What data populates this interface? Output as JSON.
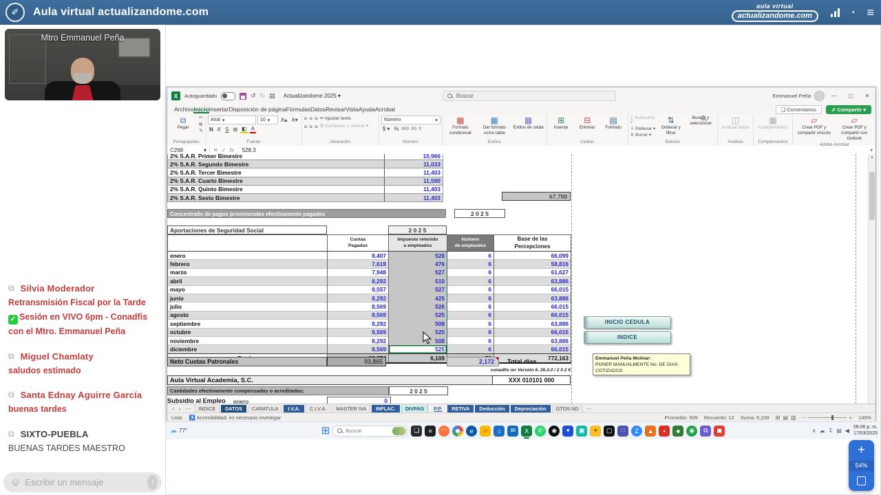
{
  "topbar": {
    "title": "Aula virtual actualizandome.com",
    "brand_line1": "aula virtual",
    "brand_line2": "actualizandome.com"
  },
  "sidebar": {
    "presenter": "Mtro Emmanuel Peña",
    "messages": {
      "m1": {
        "author": "Silvia Moderador",
        "line1": "Retransmisión Fiscal por la Tarde",
        "line2": "Sesión en VIVO 6pm - Conadfis con el Mtro. Emmanuel Peña"
      },
      "m2": {
        "author": "Miguel Chamlaty",
        "line1": "saludos estimado"
      },
      "m3": {
        "author": "Santa Ednay Aguirre García",
        "line1": "buenas tardes"
      },
      "m4": {
        "author": "SIXTO-PUEBLA",
        "line1": "BUENAS TARDES MAESTRO"
      }
    },
    "input_placeholder": "Escribir un mensaje"
  },
  "zoom_widget": {
    "percent": "54%"
  },
  "excel": {
    "titlebar": {
      "autosave_label": "Autoguardado",
      "doc_title": "Actualizandome 2025",
      "search_placeholder": "Buscar",
      "user": "Emmanuel Peña"
    },
    "actions": {
      "comments": "Comentarios",
      "share": "Compartir"
    },
    "menu": [
      {
        "label": "Archivo"
      },
      {
        "label": "Inicio",
        "mod": "active"
      },
      {
        "label": "Insertar"
      },
      {
        "label": "Disposición de página"
      },
      {
        "label": "Fórmulas"
      },
      {
        "label": "Datos"
      },
      {
        "label": "Revisar"
      },
      {
        "label": "Vista"
      },
      {
        "label": "Ayuda"
      },
      {
        "label": "Acrobat"
      }
    ],
    "ribbon": {
      "paste": "Pegar",
      "clipboard_group": "Portapapeles",
      "font_name": "Arial",
      "font_size": "10",
      "bold": "N",
      "italic": "K",
      "underline": "S",
      "font_group": "Fuente",
      "wrap": "Ajustar texto",
      "merge": "Combinar y centrar",
      "align_group": "Alineación",
      "number_format": "Número",
      "number_group": "Número",
      "currency": "$",
      "percent": "%",
      "thousands": "000",
      "cond": "Formato condicional",
      "tablefmt": "Dar formato como tabla",
      "cellstyles": "Estilos de celda",
      "styles_group": "Estilos",
      "insert": "Insertar",
      "delete": "Eliminar",
      "format": "Formato",
      "cells_group": "Celdas",
      "autosum": "Autosuma",
      "fill": "Rellenar",
      "clear": "Borrar",
      "sort": "Ordenar y filtrar",
      "find": "Buscar y seleccionar",
      "edit_group": "Edición",
      "analyze": "Analizar datos",
      "analysis_group": "Análisis",
      "addins": "Complementos",
      "addins_group": "Complementos",
      "pdf1": "Crear PDF y compartir vínculo",
      "pdf2": "Crear PDF y compartir con Outlook",
      "acrobat_group": "Adobe Acrobat"
    },
    "formula_bar": {
      "name_box": "C268",
      "fx": "fx",
      "value": "528.3"
    },
    "sheet": {
      "sar_rows": [
        {
          "label": "2% S.A.R.   Primer Bimestre",
          "value": "10,966"
        },
        {
          "label": "2% S.A.R.   Segundo Bimestre",
          "value": "11,033"
        },
        {
          "label": "2% S.A.R.   Tercer Bimestre",
          "value": "11,403"
        },
        {
          "label": "2% S.A.R.   Cuarto Bimestre",
          "value": "11,590"
        },
        {
          "label": "2% S.A.R.   Quinto Bimestre",
          "value": "11,403"
        },
        {
          "label": "2% S.A.R.   Sexto Bimestre",
          "value": "11,403"
        }
      ],
      "sar_total": "67,799",
      "concentrado_title": "Concentrado de pagos provisionales efectivamente pagados",
      "concentrado_year": "2 0 2 5",
      "table_title": "Aportaciones de Seguridad Social",
      "table_year": "2 0 2 5",
      "headers": {
        "h1l1": "Cuotas",
        "h1l2": "Pagadas",
        "h2l1": "Impuesto retenido",
        "h2l2": "a empleados",
        "h3l1": "Número",
        "h3l2": "de empleados",
        "h4l1": "Base de las",
        "h4l2": "Percepciones"
      },
      "months": [
        {
          "m": "enero",
          "c": "8,407",
          "i": "528",
          "n": "6",
          "b": "66,099"
        },
        {
          "m": "febrero",
          "c": "7,619",
          "i": "476",
          "n": "6",
          "b": "58,816"
        },
        {
          "m": "marzo",
          "c": "7,948",
          "i": "527",
          "n": "6",
          "b": "61,627"
        },
        {
          "m": "abril",
          "c": "8,292",
          "i": "510",
          "n": "6",
          "b": "63,886"
        },
        {
          "m": "mayo",
          "c": "8,557",
          "i": "527",
          "n": "6",
          "b": "66,015"
        },
        {
          "m": "junio",
          "c": "8,292",
          "i": "425",
          "n": "6",
          "b": "63,886"
        },
        {
          "m": "julio",
          "c": "8,569",
          "i": "526",
          "n": "6",
          "b": "66,015"
        },
        {
          "m": "agosto",
          "c": "8,569",
          "i": "525",
          "n": "6",
          "b": "66,015"
        },
        {
          "m": "septiembre",
          "c": "8,292",
          "i": "508",
          "n": "6",
          "b": "63,886"
        },
        {
          "m": "octubre",
          "c": "8,569",
          "i": "525",
          "n": "6",
          "b": "66,015"
        },
        {
          "m": "noviembre",
          "c": "8,292",
          "i": "508",
          "n": "6",
          "b": "63,886"
        },
        {
          "m": "diciembre",
          "c": "8,569",
          "i": "525",
          "n": "6",
          "b": "66,015"
        }
      ],
      "totals": {
        "label": "Totales",
        "c": "99,974",
        "i": "6,109",
        "n": "72",
        "b": "772,163"
      },
      "neto_label": "Neto Cuotas Patronales",
      "neto_value": "93,865",
      "dias_value": "2,172",
      "dias_label": "Total días",
      "version_line": "conadfis mr Versión 6.  26.3.0 / 2 0 2 6",
      "company": "Aula Virtual Academia, S.C.",
      "company_code": "XXX 010101 000",
      "cantidades_label": "Cantidades efectivamente compensadas o acreditadas:",
      "cantidades_year": "2 0 2 5",
      "subsidio_label": "Subsidio al Empleo",
      "subsidio_month": "enero",
      "subsidio_value": "0",
      "btn_inicio": "INICIO CEDULA",
      "btn_indice": "INDICE",
      "note_author": "Emmanuel Peña Molinar:",
      "note_text": "PONER MANUALMENTE No. DE DIAS COTIZADOS"
    },
    "sheet_tabs": [
      {
        "label": "INDICE"
      },
      {
        "label": "DATOS",
        "mod": "active"
      },
      {
        "label": "CARATULA"
      },
      {
        "label": "I.V.A.",
        "mod": "blue"
      },
      {
        "label": "C.I.V.A."
      },
      {
        "label": "MASTER IVA"
      },
      {
        "label": "INFLAC.",
        "mod": "blue"
      },
      {
        "label": "DIVPAG",
        "mod": "teal"
      },
      {
        "label": "P.P.",
        "mod": "pp"
      },
      {
        "label": "RETIVA",
        "mod": "blue"
      },
      {
        "label": "Deducción",
        "mod": "blue"
      },
      {
        "label": "Depreciación",
        "mod": "blue"
      },
      {
        "label": "GTOS ND"
      }
    ],
    "status_bar": {
      "ready": "Listo",
      "accessibility": "Accesibilidad: es necesario investigar",
      "average": "Promedio: 509",
      "count": "Recuento: 12",
      "sum": "Suma: 6,109",
      "zoom": "140%"
    }
  },
  "taskbar": {
    "weather": "77°",
    "search_placeholder": "Buscar",
    "clock_time": "06:06 p. m.",
    "clock_date": "17/03/2025",
    "icons": [
      {
        "name": "taskbar-widgets-icon",
        "glyph": "❏",
        "bg": "#26262b"
      },
      {
        "name": "taskbar-notes-icon",
        "glyph": "≡",
        "bg": "#1f1f1f"
      },
      {
        "name": "taskbar-firefox-icon",
        "glyph": "◠",
        "bg": "#ff7139",
        "mod": "round"
      },
      {
        "name": "taskbar-chrome-icon",
        "glyph": "",
        "mod": "chrome"
      },
      {
        "name": "taskbar-edge-icon",
        "glyph": "e",
        "bg": "#0c59a4",
        "mod": "round"
      },
      {
        "name": "taskbar-explorer-icon",
        "glyph": "▱",
        "bg": "#ffb900",
        "fg": "#8a5a00"
      },
      {
        "name": "taskbar-store-icon",
        "glyph": "⌂",
        "bg": "#1a6fc4"
      },
      {
        "name": "taskbar-outlook-icon",
        "glyph": "✉",
        "bg": "#0f6cbd"
      },
      {
        "name": "taskbar-excel-icon",
        "glyph": "X",
        "bg": "#107c41",
        "mod": "active"
      },
      {
        "name": "taskbar-whatsapp-icon",
        "glyph": "✆",
        "bg": "#25d366",
        "mod": "round"
      },
      {
        "name": "taskbar-obs-icon",
        "glyph": "◉",
        "bg": "#0d0d0d",
        "mod": "round"
      },
      {
        "name": "taskbar-app-blue-icon",
        "glyph": "✦",
        "bg": "#1d4ed8"
      },
      {
        "name": "taskbar-app-teal-icon",
        "glyph": "▣",
        "bg": "#14b8a6"
      },
      {
        "name": "taskbar-app-yellow-icon",
        "glyph": "✦",
        "bg": "#fbbf24",
        "fg": "#7a5200"
      },
      {
        "name": "taskbar-camera-icon",
        "glyph": "▢",
        "bg": "#111111"
      },
      {
        "name": "taskbar-teams-icon",
        "glyph": "∷",
        "bg": "#4f52b2"
      },
      {
        "name": "taskbar-zoom-icon",
        "glyph": "Z",
        "bg": "#2d8cff",
        "mod": "round"
      },
      {
        "name": "taskbar-vlc-icon",
        "glyph": "▲",
        "bg": "#e8711a"
      },
      {
        "name": "taskbar-app-red-icon",
        "glyph": "▪",
        "bg": "#d93025"
      },
      {
        "name": "taskbar-tree-icon",
        "glyph": "♣",
        "bg": "#2e7d32"
      },
      {
        "name": "taskbar-app-green-icon",
        "glyph": "◉",
        "bg": "#22a04a",
        "mod": "round"
      },
      {
        "name": "taskbar-remote-icon",
        "glyph": "⧉",
        "bg": "#6d5bd0"
      },
      {
        "name": "taskbar-rec-icon",
        "glyph": "◼",
        "bg": "#e53935"
      }
    ],
    "tray": [
      {
        "name": "tray-expand-icon",
        "glyph": "∧"
      },
      {
        "name": "tray-onedrive-icon",
        "glyph": "☁"
      },
      {
        "name": "tray-download-icon",
        "glyph": "↧"
      },
      {
        "name": "tray-network-icon",
        "glyph": "▤"
      },
      {
        "name": "tray-volume-icon",
        "glyph": "◀"
      }
    ]
  },
  "icons": {
    "logo": "✐",
    "menu": "≡",
    "dot": "•",
    "copy": "⧉",
    "check": "✓",
    "smiley": "☺",
    "send": "↑",
    "excel_logo": "X",
    "undo": "↺",
    "redo": "↻",
    "doc": "▤",
    "caret": "▾",
    "caret_up": "▴",
    "minimize": "—",
    "maximize": "▢",
    "close": "✕",
    "comments": "❑",
    "share": "⇗",
    "paste": "⧉",
    "cut": "✄",
    "painter": "✎",
    "borders": "⊞",
    "fillcolor": "◧",
    "fontcolor": "A",
    "align": "≡",
    "wrap": "↩",
    "merge": "⊞",
    "cond": "▦",
    "tablefmt": "▦",
    "cellstyles": "▦",
    "insert": "⊞",
    "delete": "⊟",
    "format": "▤",
    "autosum": "∑",
    "filldown": "⇩",
    "clear": "✕",
    "sort": "⇅",
    "analyze": "◫",
    "addins": "▦",
    "pdf": "▱",
    "fx_cancel": "✕",
    "fx_ok": "✓",
    "accessibility": "♿",
    "view_normal": "⊞",
    "view_layout": "▤",
    "view_break": "▥",
    "zoom_minus": "−",
    "zoom_plus": "+",
    "start": "⊞",
    "scroll_up": "▲",
    "tab_prev": "‹",
    "tab_next": "›",
    "tab_more": "⋯",
    "widget_plus": "+"
  }
}
